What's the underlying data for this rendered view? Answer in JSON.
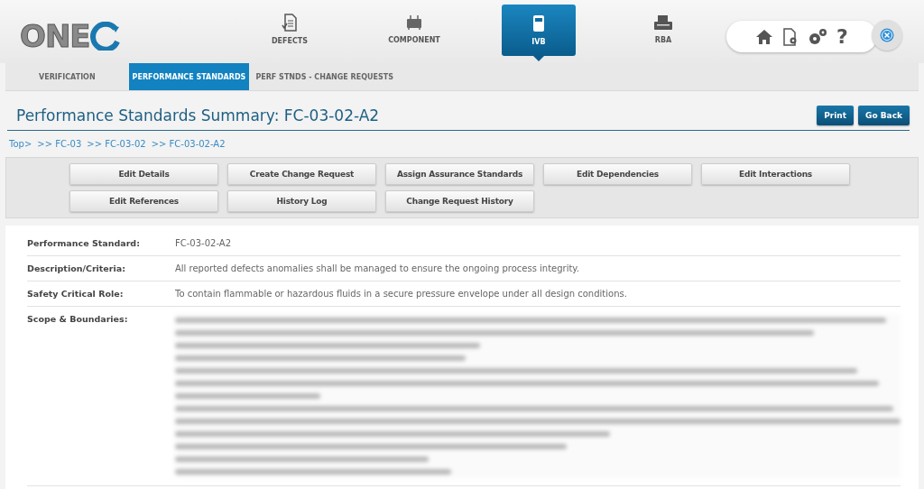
{
  "logo": {
    "text": "ONE"
  },
  "nav": [
    {
      "label": "DEFECTS",
      "selected": false
    },
    {
      "label": "COMPONENT",
      "selected": false
    },
    {
      "label": "IVB",
      "selected": true
    },
    {
      "label": "RBA",
      "selected": false
    }
  ],
  "help": "?",
  "subnav": [
    {
      "label": "VERIFICATION",
      "selected": false
    },
    {
      "label": "PERFORMANCE STANDARDS",
      "selected": true
    },
    {
      "label": "PERF STNDS - CHANGE REQUESTS",
      "selected": false
    }
  ],
  "page_title": "Performance Standards Summary: FC-03-02-A2",
  "header_buttons": [
    "Print",
    "Go Back"
  ],
  "breadcrumb": [
    "Top>",
    ">> FC-03",
    ">> FC-03-02",
    ">> FC-03-02-A2"
  ],
  "actions": [
    [
      "Edit Details",
      "Create Change Request",
      "Assign Assurance Standards",
      "Edit Dependencies",
      "Edit Interactions"
    ],
    [
      "Edit References",
      "History Log",
      "Change Request History"
    ]
  ],
  "details": [
    {
      "label": "Performance Standard:",
      "value": "FC-03-02-A2",
      "kind": "text"
    },
    {
      "label": "Description/Criteria:",
      "value": "All reported defects anomalies shall be managed to ensure the ongoing process integrity.",
      "kind": "text"
    },
    {
      "label": "Safety Critical Role:",
      "value": "To contain flammable or hazardous fluids in a secure pressure envelope under all design conditions.",
      "kind": "text"
    },
    {
      "label": "Scope & Boundaries:",
      "kind": "blurred"
    }
  ]
}
